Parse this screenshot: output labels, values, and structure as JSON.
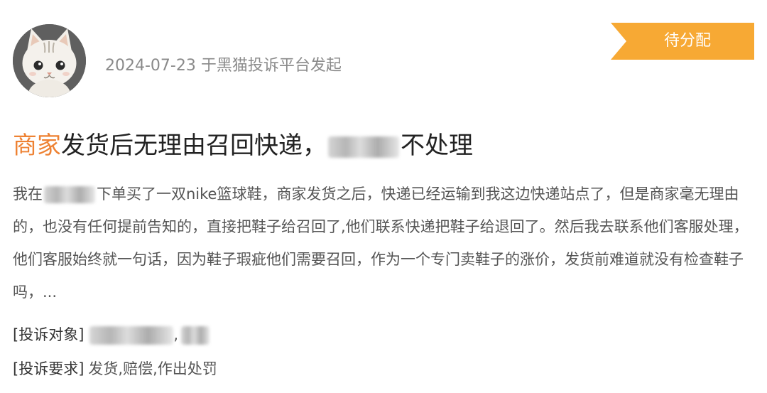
{
  "header": {
    "meta": "2024-07-23 于黑猫投诉平台发起",
    "status": "待分配"
  },
  "complaint": {
    "title_highlight": "商家",
    "title_part1": "发货后无理由召回快递，",
    "title_part2": "不处理",
    "body_part1": "我在",
    "body_part2": "下单买了一双nike篮球鞋，商家发货之后，快递已经运输到我这边快递站点了，但是商家毫无理由的，也没有任何提前告知的，直接把鞋子给召回了,他们联系快递把鞋子给退回了。然后我去联系他们客服处理，他们客服始终就一句话，因为鞋子瑕疵他们需要召回，作为一个专门卖鞋子的涨价，发货前难道就没有检查鞋子吗，...",
    "target_label": "[投诉对象]",
    "target_sep": ",",
    "demand_label": "[投诉要求]",
    "demand_value": "发货,赔偿,作出处罚"
  },
  "colors": {
    "accent": "#ee8233",
    "badge": "#f7a934",
    "meta": "#8a8a8a",
    "text": "#555555"
  },
  "icons": {
    "avatar": "cat-avatar-icon"
  }
}
